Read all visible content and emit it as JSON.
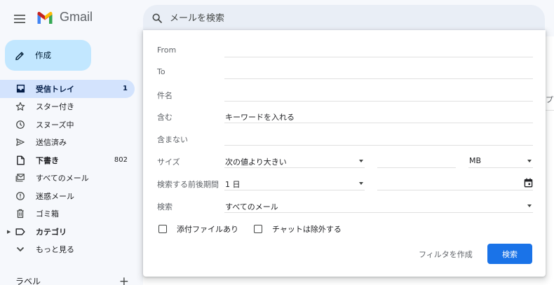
{
  "header": {
    "logo_text": "Gmail",
    "search_placeholder": "メールを検索"
  },
  "compose": {
    "label": "作成"
  },
  "nav": [
    {
      "label": "受信トレイ",
      "count": "1",
      "icon": "inbox-icon"
    },
    {
      "label": "スター付き",
      "count": "",
      "icon": "star-icon"
    },
    {
      "label": "スヌーズ中",
      "count": "",
      "icon": "clock-icon"
    },
    {
      "label": "送信済み",
      "count": "",
      "icon": "send-icon"
    },
    {
      "label": "下書き",
      "count": "802",
      "icon": "draft-icon"
    },
    {
      "label": "すべてのメール",
      "count": "",
      "icon": "all-mail-icon"
    },
    {
      "label": "迷惑メール",
      "count": "",
      "icon": "spam-icon"
    },
    {
      "label": "ゴミ箱",
      "count": "",
      "icon": "trash-icon"
    },
    {
      "label": "カテゴリ",
      "count": "",
      "icon": "label-icon"
    },
    {
      "label": "もっと見る",
      "count": "",
      "icon": "chevron-down-icon"
    }
  ],
  "labels_section": {
    "title": "ラベル",
    "add": "+"
  },
  "main": {
    "edge_text": "プ"
  },
  "search_panel": {
    "from_label": "From",
    "to_label": "To",
    "subject_label": "件名",
    "has_words_label": "含む",
    "has_words_value": "キーワードを入れる",
    "doesnt_have_label": "含まない",
    "size_label": "サイズ",
    "size_operator": "次の値より大きい",
    "size_unit": "MB",
    "date_label": "検索する前後期間",
    "date_range": "1 日",
    "search_in_label": "検索",
    "search_in_value": "すべてのメール",
    "has_attachment_label": "添付ファイルあり",
    "exclude_chats_label": "チャットは除外する",
    "create_filter_label": "フィルタを作成",
    "search_button_label": "検索"
  },
  "colors": {
    "accent": "#1a73e8",
    "compose_bg": "#c2e7ff",
    "active_nav_bg": "#d3e3fd",
    "page_bg": "#f6f8fc"
  }
}
